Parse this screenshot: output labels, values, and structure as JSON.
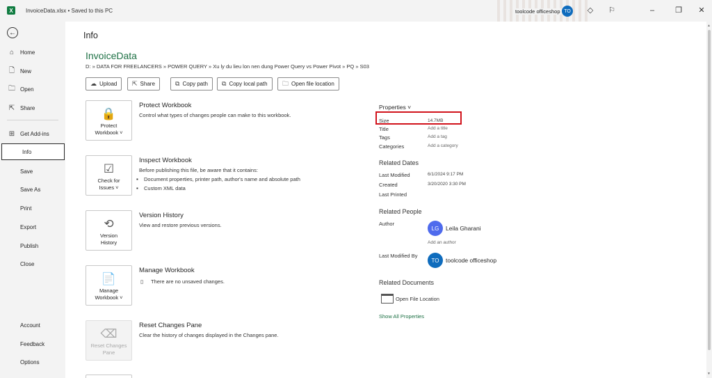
{
  "titlebar": {
    "app_logo": "X",
    "document_title": "InvoiceData.xlsx • Saved to this PC",
    "user_name": "toolcode officeshop",
    "user_initials": "TO",
    "icons": [
      "diamond-icon",
      "coauthor-icon",
      "minimize-icon",
      "restore-icon",
      "close-icon"
    ]
  },
  "nav": {
    "back_icon": "←",
    "items": [
      {
        "label": "Home",
        "icon": "⌂"
      },
      {
        "label": "New",
        "icon": "🗋"
      },
      {
        "label": "Open",
        "icon": "🗀"
      },
      {
        "label": "Share",
        "icon": "⇱"
      },
      {
        "label": "Get Add-ins",
        "icon": "⊞"
      },
      {
        "label": "Info",
        "selected": true
      },
      {
        "label": "Save"
      },
      {
        "label": "Save As"
      },
      {
        "label": "Print"
      },
      {
        "label": "Export"
      },
      {
        "label": "Publish"
      },
      {
        "label": "Close"
      }
    ],
    "bottom_items": [
      {
        "label": "Account"
      },
      {
        "label": "Feedback"
      },
      {
        "label": "Options"
      }
    ]
  },
  "main": {
    "title": "Info",
    "file_name": "InvoiceData",
    "file_path": "D: » DATA FOR FREELANCERS » POWER QUERY » Xu ly du lieu lon nen dung Power Query vs Power Pivot » PQ » S03",
    "actions": [
      {
        "label": "Upload",
        "icon": "☁"
      },
      {
        "label": "Share",
        "icon": "⇱"
      },
      {
        "label": "Copy path",
        "icon": "⧉"
      },
      {
        "label": "Copy local path",
        "icon": "⧉"
      },
      {
        "label": "Open file location",
        "icon": "🗀"
      }
    ],
    "sections": [
      {
        "button_line1": "Protect",
        "button_line2": "Workbook ˅",
        "icon": "🔒",
        "title": "Protect Workbook",
        "description": "Control what types of changes people can make to this workbook."
      },
      {
        "button_line1": "Check for",
        "button_line2": "Issues ˅",
        "icon": "☑",
        "title": "Inspect Workbook",
        "description": "Before publishing this file, be aware that it contains:",
        "bullets": [
          "Document properties, printer path, author's name and absolute path",
          "Custom XML data"
        ]
      },
      {
        "button_line1": "Version",
        "button_line2": "History",
        "icon": "⟲",
        "title": "Version History",
        "description": "View and restore previous versions."
      },
      {
        "button_line1": "Manage",
        "button_line2": "Workbook ˅",
        "icon": "📄",
        "title": "Manage Workbook",
        "description": "There are no unsaved changes."
      },
      {
        "button_line1": "Reset Changes",
        "button_line2": "Pane",
        "icon": "⌫",
        "title": "Reset Changes Pane",
        "description": "Clear the history of changes displayed in the Changes pane."
      }
    ]
  },
  "properties": {
    "header": "Properties ˅",
    "rows": [
      {
        "label": "Size",
        "value": "14.7MB"
      },
      {
        "label": "Title",
        "value": "Add a title"
      },
      {
        "label": "Tags",
        "value": "Add a tag"
      },
      {
        "label": "Categories",
        "value": "Add a category"
      }
    ],
    "related_dates": {
      "header": "Related Dates",
      "rows": [
        {
          "label": "Last Modified",
          "value": "6/1/2024 9:17 PM"
        },
        {
          "label": "Created",
          "value": "3/20/2020 3:30 PM"
        },
        {
          "label": "Last Printed",
          "value": ""
        }
      ]
    },
    "related_people": {
      "header": "Related People",
      "author_label": "Author",
      "author_initials": "LG",
      "author_name": "Leila Gharani",
      "author_color": "#4f6bed",
      "add_author": "Add an author",
      "last_modified_by_label": "Last Modified By",
      "modifier_initials": "TO",
      "modifier_name": "toolcode officeshop",
      "modifier_color": "#0f6cbd"
    },
    "related_documents": {
      "header": "Related Documents",
      "open_location": "Open File Location"
    },
    "show_all": "Show All Properties",
    "highlight_color": "#d1121b"
  }
}
